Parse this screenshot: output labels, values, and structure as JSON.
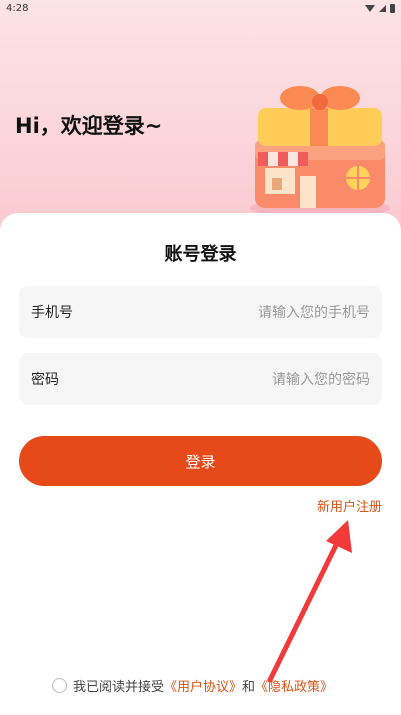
{
  "status": {
    "time": "4:28"
  },
  "greeting": "Hi，欢迎登录~",
  "form": {
    "title": "账号登录",
    "phone_label": "手机号",
    "phone_placeholder": "请输入您的手机号",
    "password_label": "密码",
    "password_placeholder": "请输入您的密码",
    "login_label": "登录",
    "register_label": "新用户注册"
  },
  "agreement": {
    "prefix": "我已阅读并接受",
    "user_agreement": "《用户协议》",
    "and": "和",
    "privacy_policy": "《隐私政策》"
  },
  "colors": {
    "accent": "#e64a19",
    "link": "#d8541a",
    "header_bg": "#fbd6da"
  },
  "icons": [
    "wifi-icon",
    "signal-icon",
    "battery-icon",
    "gift-shop-illustration",
    "red-arrow-annotation"
  ]
}
